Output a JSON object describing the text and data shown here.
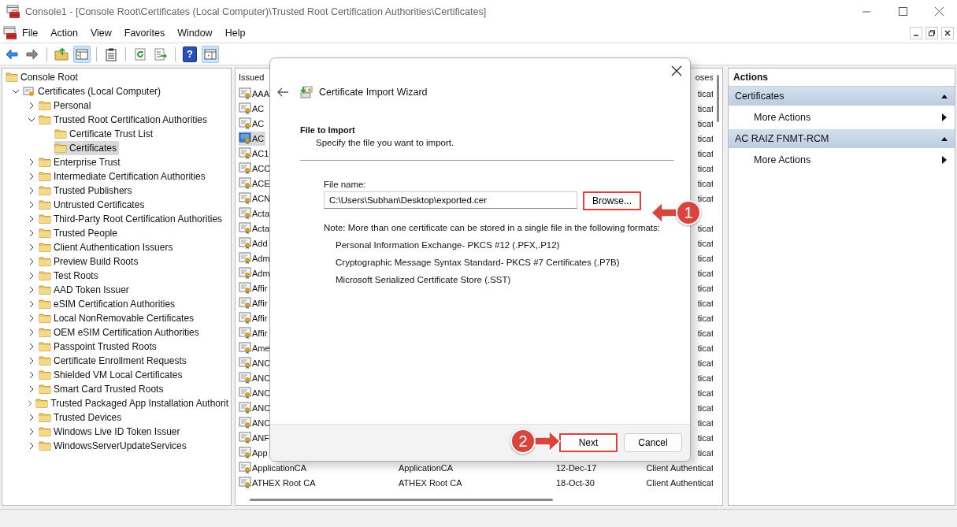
{
  "window": {
    "title": "Console1 - [Console Root\\Certificates (Local Computer)\\Trusted Root Certification Authorities\\Certificates]"
  },
  "menu": [
    "File",
    "Action",
    "View",
    "Favorites",
    "Window",
    "Help"
  ],
  "toolbar": [
    {
      "kind": "back",
      "pressed": false
    },
    {
      "kind": "forward",
      "pressed": false
    },
    {
      "kind": "sep"
    },
    {
      "kind": "up",
      "pressed": false
    },
    {
      "kind": "tree",
      "pressed": true
    },
    {
      "kind": "sep"
    },
    {
      "kind": "properties",
      "pressed": false
    },
    {
      "kind": "sep"
    },
    {
      "kind": "refresh",
      "pressed": false
    },
    {
      "kind": "export",
      "pressed": false
    },
    {
      "kind": "sep"
    },
    {
      "kind": "help",
      "label": "?",
      "pressed": false
    },
    {
      "kind": "pane",
      "pressed": true
    }
  ],
  "tree": [
    {
      "label": "Console Root",
      "kind": "root",
      "selected": false,
      "children": [
        {
          "label": "Certificates (Local Computer)",
          "kind": "store",
          "expanded": true,
          "selected": false,
          "children": [
            {
              "label": "Personal",
              "kind": "branch",
              "expanded": false,
              "selected": false
            },
            {
              "label": "Trusted Root Certification Authorities",
              "kind": "branch",
              "expanded": true,
              "selected": false,
              "children": [
                {
                  "label": "Certificate Trust List",
                  "kind": "leaf",
                  "selected": false
                },
                {
                  "label": "Certificates",
                  "kind": "leaf",
                  "selected": true
                }
              ]
            },
            {
              "label": "Enterprise Trust",
              "kind": "branch",
              "expanded": false,
              "selected": false
            },
            {
              "label": "Intermediate Certification Authorities",
              "kind": "branch",
              "expanded": false,
              "selected": false
            },
            {
              "label": "Trusted Publishers",
              "kind": "branch",
              "expanded": false,
              "selected": false
            },
            {
              "label": "Untrusted Certificates",
              "kind": "branch",
              "expanded": false,
              "selected": false
            },
            {
              "label": "Third-Party Root Certification Authorities",
              "kind": "branch",
              "expanded": false,
              "selected": false
            },
            {
              "label": "Trusted People",
              "kind": "branch",
              "expanded": false,
              "selected": false
            },
            {
              "label": "Client Authentication Issuers",
              "kind": "branch",
              "expanded": false,
              "selected": false
            },
            {
              "label": "Preview Build Roots",
              "kind": "branch",
              "expanded": false,
              "selected": false
            },
            {
              "label": "Test Roots",
              "kind": "branch",
              "expanded": false,
              "selected": false
            },
            {
              "label": "AAD Token Issuer",
              "kind": "branch",
              "expanded": false,
              "selected": false
            },
            {
              "label": "eSIM Certification Authorities",
              "kind": "branch",
              "expanded": false,
              "selected": false
            },
            {
              "label": "Local NonRemovable Certificates",
              "kind": "branch",
              "expanded": false,
              "selected": false
            },
            {
              "label": "OEM eSIM Certification Authorities",
              "kind": "branch",
              "expanded": false,
              "selected": false
            },
            {
              "label": "Passpoint Trusted Roots",
              "kind": "branch",
              "expanded": false,
              "selected": false
            },
            {
              "label": "Certificate Enrollment Requests",
              "kind": "branch",
              "expanded": false,
              "selected": false
            },
            {
              "label": "Shielded VM Local Certificates",
              "kind": "branch",
              "expanded": false,
              "selected": false
            },
            {
              "label": "Smart Card Trusted Roots",
              "kind": "branch",
              "expanded": false,
              "selected": false
            },
            {
              "label": "Trusted Packaged App Installation Authorit",
              "kind": "branch",
              "expanded": false,
              "selected": false
            },
            {
              "label": "Trusted Devices",
              "kind": "branch",
              "expanded": false,
              "selected": false
            },
            {
              "label": "Windows Live ID Token Issuer",
              "kind": "branch",
              "expanded": false,
              "selected": false
            },
            {
              "label": "WindowsServerUpdateServices",
              "kind": "branch",
              "expanded": false,
              "selected": false
            }
          ]
        }
      ]
    }
  ],
  "list": {
    "column_1": "Issued",
    "column_4": "oses",
    "rows": [
      {
        "column_1": "AAA",
        "column_4": "ticat",
        "selected": false
      },
      {
        "column_1": "AC",
        "column_4": "ticat",
        "selected": false
      },
      {
        "column_1": "AC",
        "column_4": "ticat",
        "selected": false
      },
      {
        "column_1": "AC",
        "column_4": "ticat",
        "selected": true
      },
      {
        "column_1": "AC1",
        "column_4": "ticat",
        "selected": false
      },
      {
        "column_1": "ACC",
        "column_4": "ticat",
        "selected": false
      },
      {
        "column_1": "ACE",
        "column_4": "ticat",
        "selected": false
      },
      {
        "column_1": "ACN",
        "column_4": "ticat",
        "selected": false
      },
      {
        "column_1": "Acta",
        "selected": false
      },
      {
        "column_1": "Acta",
        "column_4": "ticat",
        "selected": false
      },
      {
        "column_1": "Add",
        "column_4": "ticat",
        "selected": false
      },
      {
        "column_1": "Adm",
        "column_4": "ticat",
        "selected": false
      },
      {
        "column_1": "Adm",
        "column_4": "ticat",
        "selected": false
      },
      {
        "column_1": "Affir",
        "column_4": "ticat",
        "selected": false
      },
      {
        "column_1": "Affir",
        "column_4": "ticat",
        "selected": false
      },
      {
        "column_1": "Affir",
        "column_4": "ticat",
        "selected": false
      },
      {
        "column_1": "Affir",
        "column_4": "ticat",
        "selected": false
      },
      {
        "column_1": "Ame",
        "column_4": "ticat",
        "selected": false
      },
      {
        "column_1": "ANC",
        "column_4": "ticat",
        "selected": false
      },
      {
        "column_1": "ANC",
        "column_4": "ticat",
        "selected": false
      },
      {
        "column_1": "ANC",
        "column_4": "ticat",
        "selected": false
      },
      {
        "column_1": "ANC",
        "column_4": "ticat",
        "selected": false
      },
      {
        "column_1": "ANC",
        "column_4": "ticat",
        "selected": false
      },
      {
        "column_1": "ANF",
        "column_4": "ticat",
        "selected": false
      },
      {
        "column_1": "App",
        "column_4": "ticat",
        "selected": false
      },
      {
        "column_1": "ApplicationCA",
        "column_2": "ApplicationCA",
        "column_3": "12-Dec-17",
        "column_4": "Client Authenticat",
        "selected": false
      },
      {
        "column_1": "ATHEX Root CA",
        "column_2": "ATHEX Root CA",
        "column_3": "18-Oct-30",
        "column_4": "Client Authenticat",
        "selected": false
      }
    ]
  },
  "actions": {
    "title": "Actions",
    "sections": [
      {
        "label": "Certificates",
        "expanded": true,
        "items": [
          "More Actions"
        ]
      },
      {
        "label": "AC RAIZ FNMT-RCM",
        "expanded": true,
        "items": [
          "More Actions"
        ]
      }
    ]
  },
  "dialog": {
    "title": "Certificate Import Wizard",
    "heading": "File to Import",
    "subheading": "Specify the file you want to import.",
    "file_label": "File name:",
    "file_value": "C:\\Users\\Subhan\\Desktop\\exported.cer",
    "browse": {
      "label": "Browse...",
      "highlighted": true
    },
    "note": "Note:  More than one certificate can be stored in a single file in the following formats:",
    "formats": [
      "Personal Information Exchange- PKCS #12 (.PFX,.P12)",
      "Cryptographic Message Syntax Standard- PKCS #7 Certificates (.P7B)",
      "Microsoft Serialized Certificate Store (.SST)"
    ],
    "buttons": [
      {
        "label": "Next",
        "highlighted": true
      },
      {
        "label": "Cancel",
        "highlighted": false
      }
    ]
  },
  "annotations": [
    {
      "label": "1",
      "kind": "left"
    },
    {
      "label": "2",
      "kind": "right"
    }
  ]
}
